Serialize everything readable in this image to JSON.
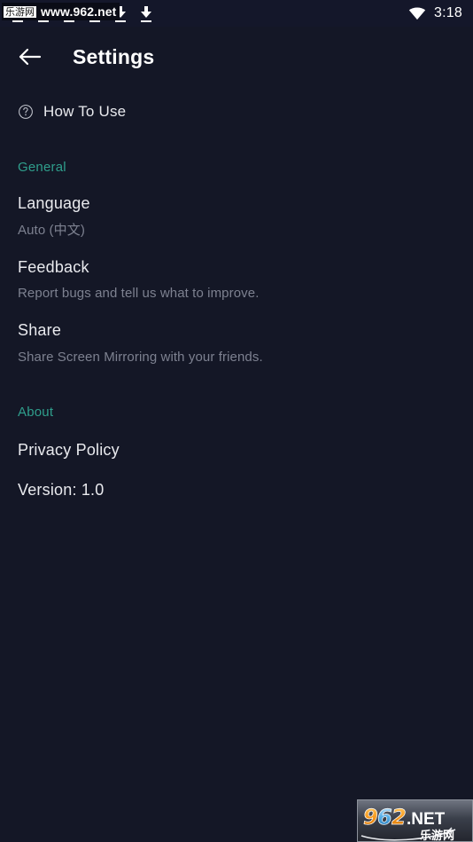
{
  "status_bar": {
    "icons": [
      "download-icon",
      "download-icon",
      "download-icon"
    ],
    "wifi_icon": "wifi-icon",
    "time": "3:18"
  },
  "watermark": {
    "badge_cn": "乐游网",
    "url": "www.962.net",
    "logo_number": "962",
    "logo_tld": ".NET",
    "logo_cn": "乐游网"
  },
  "app_bar": {
    "back_icon": "arrow-left-icon",
    "title": "Settings"
  },
  "how_to_use": {
    "icon": "help-circle-icon",
    "label": "How To Use"
  },
  "sections": [
    {
      "header": "General",
      "items": [
        {
          "title": "Language",
          "subtitle": "Auto (中文)"
        },
        {
          "title": "Feedback",
          "subtitle": "Report bugs and tell us what to improve."
        },
        {
          "title": "Share",
          "subtitle": "Share Screen Mirroring with your friends."
        }
      ]
    },
    {
      "header": "About",
      "items": [
        {
          "title": "Privacy Policy",
          "subtitle": ""
        },
        {
          "title": "Version: 1.0",
          "subtitle": ""
        }
      ]
    }
  ],
  "colors": {
    "background": "#141726",
    "accent_teal": "#2f9e8c",
    "primary_text": "#e9eaee",
    "secondary_text": "#7d8190"
  }
}
